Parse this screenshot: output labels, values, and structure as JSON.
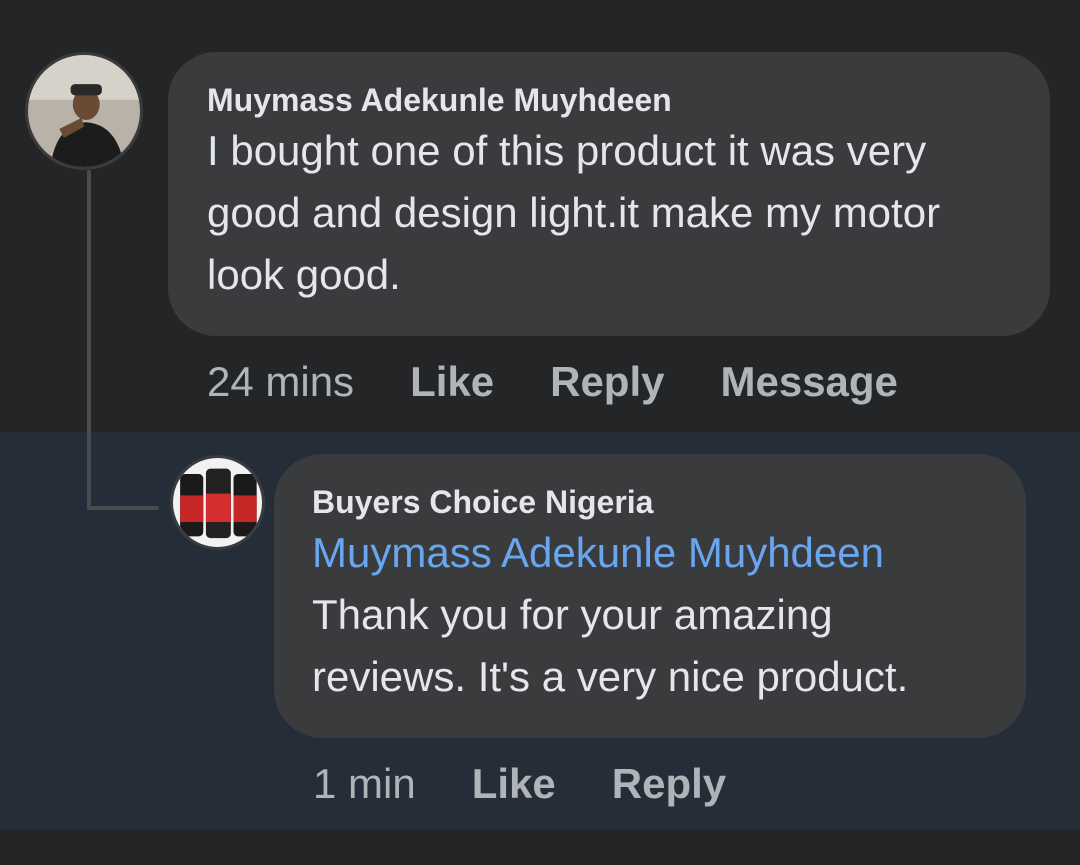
{
  "comments": [
    {
      "author": "Muymass Adekunle Muyhdeen",
      "text": "I bought one of this product it was very good and design light.it make my motor look good.",
      "timestamp": "24 mins",
      "actions": {
        "like": "Like",
        "reply": "Reply",
        "message": "Message"
      }
    }
  ],
  "reply": {
    "author": "Buyers Choice Nigeria",
    "mention": "Muymass Adekunle Muyhdeen",
    "text": "Thank you for your amazing reviews. It's a very nice product.",
    "timestamp": "1 min",
    "actions": {
      "like": "Like",
      "reply": "Reply"
    }
  },
  "colors": {
    "background": "#242526",
    "reply_background": "#252d39",
    "bubble": "#3a3b3c",
    "mention": "#6aa6f0",
    "meta_text": "#b0b3b8"
  }
}
